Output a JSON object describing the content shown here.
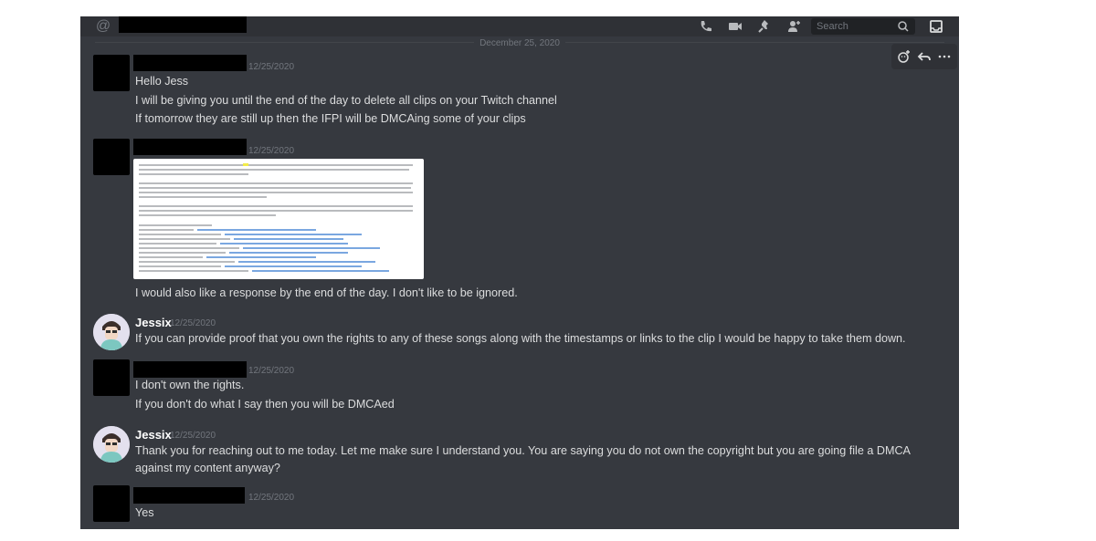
{
  "header": {
    "search_placeholder": "Search"
  },
  "date_divider": "December 25, 2020",
  "messages": [
    {
      "timestamp": "12/25/2020",
      "lines": [
        "Hello Jess",
        "I will be giving you until the end of the day to delete all clips on your Twitch channel",
        "If tomorrow they are still up then the IFPI will be DMCAing some of your clips"
      ]
    },
    {
      "timestamp": "12/25/2020",
      "lines": [
        "I would also like a response by the end of the day. I don't like to be ignored."
      ]
    },
    {
      "username": "Jessix",
      "timestamp": "12/25/2020",
      "lines": [
        "If you  can provide proof that you own the rights to any of these songs along with the timestamps or links to the clip  I would be happy to take them down."
      ]
    },
    {
      "timestamp": "12/25/2020",
      "lines": [
        "I don't own the rights.",
        "If you don't do what I say then you will be DMCAed"
      ]
    },
    {
      "username": "Jessix",
      "timestamp": "12/25/2020",
      "lines": [
        "Thank you for reaching out to me today. Let me make sure I understand you.  You are saying you do not own the copyright but you are going file a DMCA against my content anyway?"
      ]
    },
    {
      "timestamp": "12/25/2020",
      "lines": [
        "Yes"
      ]
    }
  ],
  "colors": {
    "background": "#36393f",
    "sidebar": "#2f3136",
    "text": "#dcddde",
    "muted": "#72767d",
    "redaction": "#000000"
  },
  "icons": [
    "at-icon",
    "phone-call-icon",
    "video-call-icon",
    "pin-icon",
    "members-icon",
    "search-icon",
    "inbox-icon",
    "add-reaction-icon",
    "reply-icon",
    "more-icon"
  ]
}
